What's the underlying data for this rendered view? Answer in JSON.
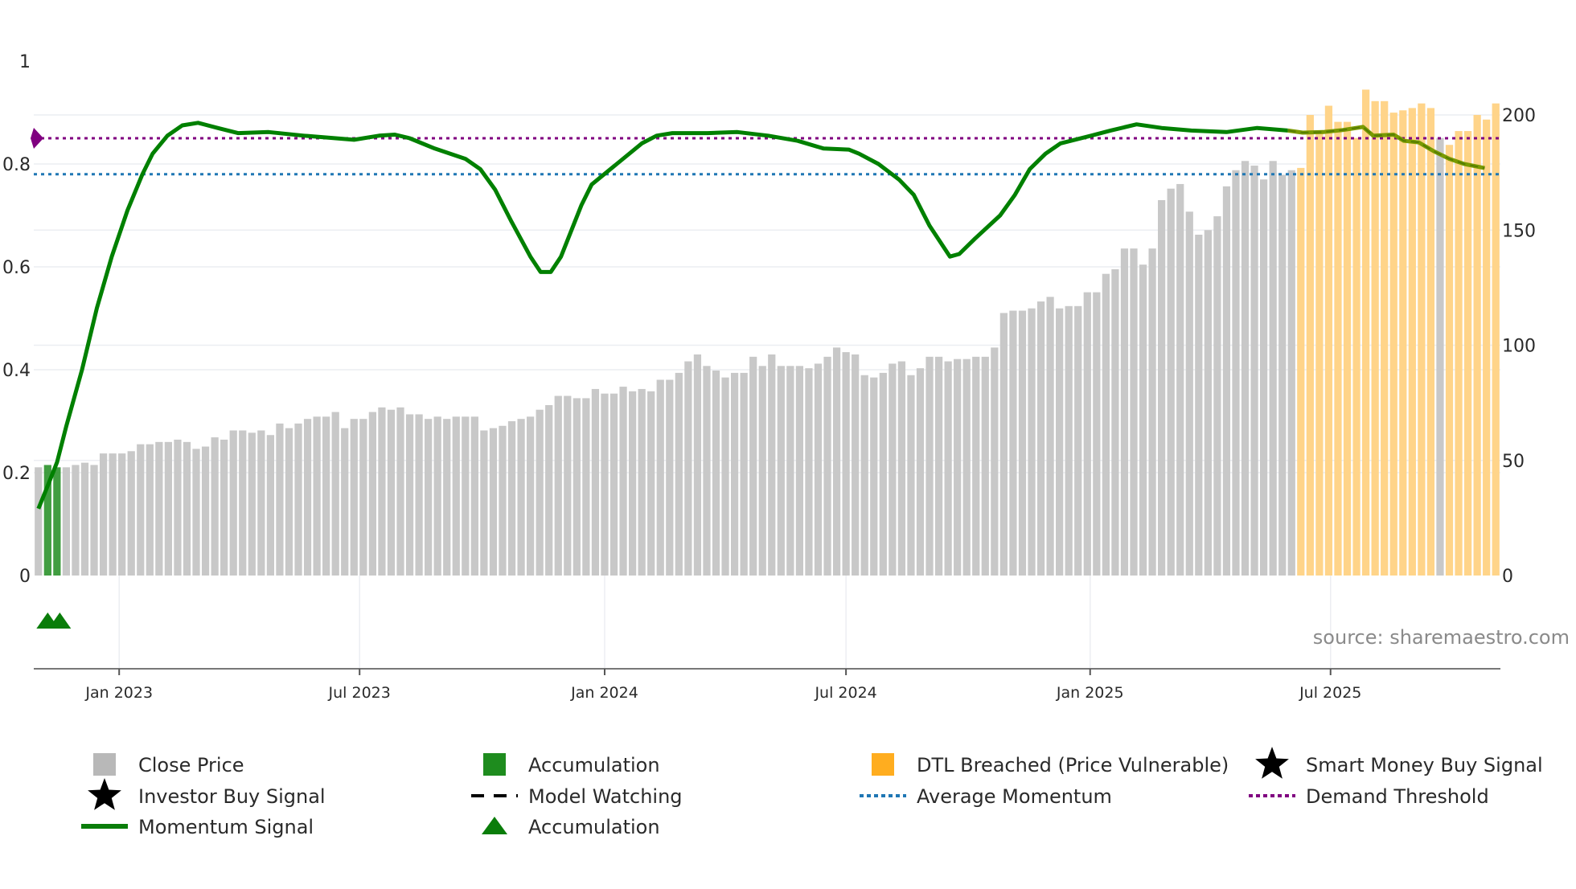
{
  "chart_data": {
    "type": "bar+line",
    "source_note": "source: sharemaestro.com",
    "left_axis": {
      "ticks": [
        "1",
        "0.8",
        "0.6",
        "0.4",
        "0.2",
        "0"
      ],
      "values": [
        1,
        0.8,
        0.6,
        0.4,
        0.2,
        0
      ],
      "range": [
        0,
        1
      ]
    },
    "right_axis": {
      "ticks": [
        "200",
        "150",
        "100",
        "50",
        "0"
      ],
      "values": [
        200,
        150,
        100,
        50,
        0
      ],
      "range": [
        0,
        212
      ]
    },
    "x_ticks": [
      {
        "label": "Jan 2023",
        "week": 8.7
      },
      {
        "label": "Jul 2023",
        "week": 34.6
      },
      {
        "label": "Jan 2024",
        "week": 61.0
      },
      {
        "label": "Jul 2024",
        "week": 87.0
      },
      {
        "label": "Jan 2025",
        "week": 113.3
      },
      {
        "label": "Jul 2025",
        "week": 139.2
      }
    ],
    "close_price": [
      47,
      48,
      47,
      47,
      48,
      49,
      48,
      53,
      53,
      53,
      54,
      57,
      57,
      58,
      58,
      59,
      58,
      55,
      56,
      60,
      59,
      63,
      63,
      62,
      63,
      61,
      66,
      64,
      66,
      68,
      69,
      69,
      71,
      64,
      68,
      68,
      71,
      73,
      72,
      73,
      70,
      70,
      68,
      69,
      68,
      69,
      69,
      69,
      63,
      64,
      65,
      67,
      68,
      69,
      72,
      74,
      78,
      78,
      77,
      77,
      81,
      79,
      79,
      82,
      80,
      81,
      80,
      85,
      85,
      88,
      93,
      96,
      91,
      89,
      86,
      88,
      88,
      95,
      91,
      96,
      91,
      91,
      91,
      90,
      92,
      95,
      99,
      97,
      96,
      87,
      86,
      88,
      92,
      93,
      87,
      90,
      95,
      95,
      93,
      94,
      94,
      95,
      95,
      99,
      114,
      115,
      115,
      116,
      119,
      121,
      116,
      117,
      117,
      123,
      123,
      131,
      133,
      142,
      142,
      135,
      142,
      163,
      168,
      170,
      158,
      148,
      150,
      156,
      169,
      176,
      180,
      178,
      172,
      180,
      174,
      176,
      177,
      200,
      193,
      204,
      197,
      197,
      190,
      211,
      206,
      206,
      201,
      202,
      203,
      205,
      203,
      190,
      187,
      193,
      193,
      200,
      198,
      205
    ],
    "bar_state": {
      "accumulation_weeks": [
        1,
        2
      ],
      "dtl_breached_from_week": 136,
      "dtl_exception_weeks": [
        151
      ]
    },
    "accumulation_markers_weeks": [
      1,
      2.3
    ],
    "momentum": {
      "week": [
        0,
        0.9,
        2,
        3,
        4.7,
        6.3,
        7.9,
        9.6,
        11.2,
        12.3,
        13.9,
        15.5,
        17.2,
        19.3,
        21.5,
        24.8,
        28.6,
        34,
        36.7,
        38.4,
        40,
        42.7,
        46,
        47.6,
        49.2,
        50.9,
        53,
        54.1,
        55.2,
        56.3,
        58.5,
        59.6,
        62.3,
        65,
        66.6,
        68.3,
        72.1,
        75.3,
        78.6,
        81.8,
        84.6,
        87.3,
        88.4,
        90.5,
        92.7,
        94.3,
        96,
        97.1,
        98.2,
        99.2,
        100.9,
        103.6,
        105.2,
        106.8,
        108.5,
        110.1,
        113.4,
        115.5,
        118.3,
        121,
        124.2,
        128,
        131.3,
        134.6,
        136.2,
        138.4,
        140.5,
        142.7,
        143.8,
        146,
        147.1,
        148.7,
        150.3,
        152,
        153.6,
        155.8
      ],
      "value": [
        0.13,
        0.17,
        0.22,
        0.29,
        0.4,
        0.52,
        0.62,
        0.71,
        0.78,
        0.82,
        0.855,
        0.875,
        0.88,
        0.87,
        0.86,
        0.862,
        0.855,
        0.847,
        0.855,
        0.857,
        0.85,
        0.83,
        0.81,
        0.79,
        0.75,
        0.69,
        0.62,
        0.59,
        0.59,
        0.62,
        0.72,
        0.76,
        0.8,
        0.84,
        0.855,
        0.86,
        0.86,
        0.862,
        0.855,
        0.845,
        0.83,
        0.828,
        0.82,
        0.8,
        0.77,
        0.74,
        0.68,
        0.65,
        0.62,
        0.625,
        0.655,
        0.7,
        0.74,
        0.79,
        0.82,
        0.84,
        0.855,
        0.865,
        0.877,
        0.87,
        0.865,
        0.862,
        0.87,
        0.865,
        0.861,
        0.862,
        0.866,
        0.872,
        0.855,
        0.857,
        0.845,
        0.842,
        0.825,
        0.81,
        0.8,
        0.792
      ]
    },
    "model_watching_from_week": 136,
    "average_momentum": 0.78,
    "demand_threshold": 0.85,
    "colors": {
      "close": "#c8c8c8",
      "accumulation": "#1e8c1e",
      "dtl": "#ffd489",
      "momentum": "#008000",
      "watching": "#7a9a00",
      "avg": "#1f77b4",
      "demand": "#800080",
      "smart": "#0000ff"
    },
    "legend": [
      {
        "label": "Close Price",
        "symbol": "square-gray"
      },
      {
        "label": "Accumulation",
        "symbol": "square-green"
      },
      {
        "label": "DTL Breached (Price Vulnerable)",
        "symbol": "square-orange"
      },
      {
        "label": "Smart Money Buy Signal",
        "symbol": "star-blue"
      },
      {
        "label": "Investor Buy Signal",
        "symbol": "star-black"
      },
      {
        "label": "Model Watching",
        "symbol": "dash-black"
      },
      {
        "label": "Average Momentum",
        "symbol": "dot-blue"
      },
      {
        "label": "Demand Threshold",
        "symbol": "dot-purple"
      },
      {
        "label": "Momentum Signal",
        "symbol": "line-green"
      },
      {
        "label": "Accumulation",
        "symbol": "triangle-green"
      }
    ]
  }
}
